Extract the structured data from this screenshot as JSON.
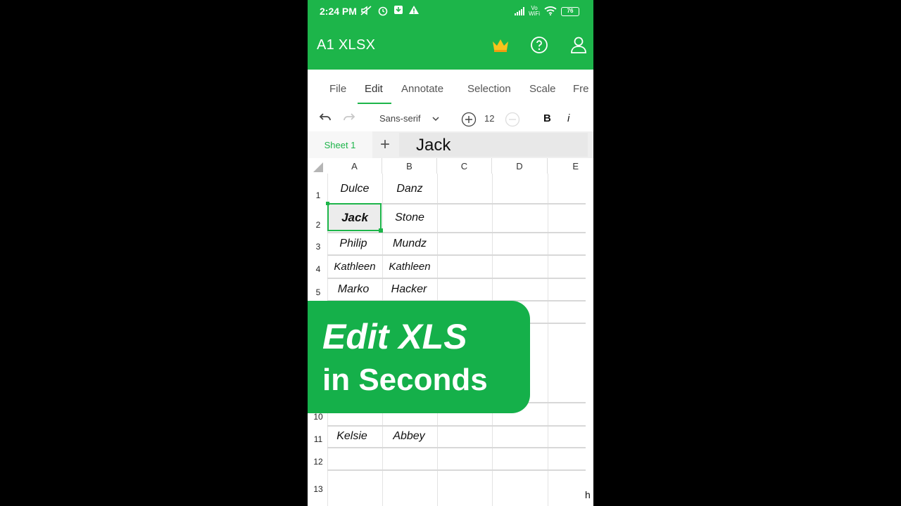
{
  "status_bar": {
    "time": "2:24 PM",
    "vowifi": "Vo\nWiFi",
    "battery": "76"
  },
  "app": {
    "title": "A1 XLSX",
    "crown_icon": "crown-icon",
    "help_icon": "help-icon",
    "account_icon": "account-icon",
    "accent_color": "#1db54a"
  },
  "menu": {
    "tabs": [
      "File",
      "Edit",
      "Annotate",
      "Selection",
      "Scale",
      "Fre"
    ],
    "active": "Edit"
  },
  "toolbar": {
    "font": "Sans-serif",
    "font_size": "12",
    "bold": "B",
    "italic": "i"
  },
  "sheet": {
    "tab_label": "Sheet 1",
    "add_label": "+",
    "formula_value": "Jack"
  },
  "grid": {
    "columns": [
      "A",
      "B",
      "C",
      "D",
      "E"
    ],
    "rows": [
      "1",
      "2",
      "3",
      "4",
      "5",
      "10",
      "11",
      "12",
      "13"
    ],
    "cells": {
      "a1": "Dulce",
      "b1": "Danz",
      "a2": "Jack",
      "b2": "Stone",
      "a3": "Philip",
      "b3": "Mundz",
      "a4": "Kathleen",
      "b4": "Kathleen",
      "a5": "Marko",
      "b5": "Hacker",
      "a11": "Kelsie",
      "b11": "Abbey"
    },
    "selected": "A2"
  },
  "banner": {
    "line1": "Edit XLS",
    "line2": "in Seconds"
  },
  "corner_text": "h"
}
